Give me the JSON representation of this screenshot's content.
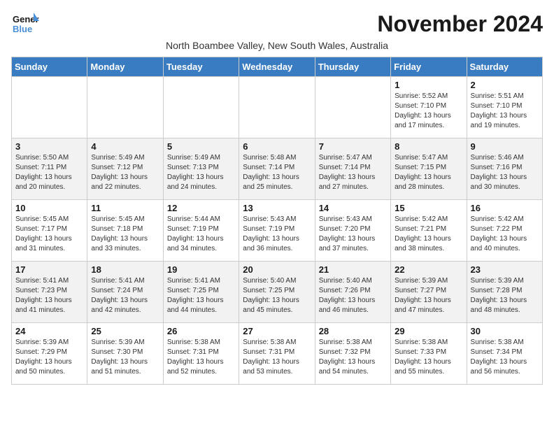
{
  "logo": {
    "line1": "General",
    "line2": "Blue"
  },
  "title": "November 2024",
  "subtitle": "North Boambee Valley, New South Wales, Australia",
  "days_of_week": [
    "Sunday",
    "Monday",
    "Tuesday",
    "Wednesday",
    "Thursday",
    "Friday",
    "Saturday"
  ],
  "weeks": [
    [
      {
        "day": "",
        "info": ""
      },
      {
        "day": "",
        "info": ""
      },
      {
        "day": "",
        "info": ""
      },
      {
        "day": "",
        "info": ""
      },
      {
        "day": "",
        "info": ""
      },
      {
        "day": "1",
        "info": "Sunrise: 5:52 AM\nSunset: 7:10 PM\nDaylight: 13 hours\nand 17 minutes."
      },
      {
        "day": "2",
        "info": "Sunrise: 5:51 AM\nSunset: 7:10 PM\nDaylight: 13 hours\nand 19 minutes."
      }
    ],
    [
      {
        "day": "3",
        "info": "Sunrise: 5:50 AM\nSunset: 7:11 PM\nDaylight: 13 hours\nand 20 minutes."
      },
      {
        "day": "4",
        "info": "Sunrise: 5:49 AM\nSunset: 7:12 PM\nDaylight: 13 hours\nand 22 minutes."
      },
      {
        "day": "5",
        "info": "Sunrise: 5:49 AM\nSunset: 7:13 PM\nDaylight: 13 hours\nand 24 minutes."
      },
      {
        "day": "6",
        "info": "Sunrise: 5:48 AM\nSunset: 7:14 PM\nDaylight: 13 hours\nand 25 minutes."
      },
      {
        "day": "7",
        "info": "Sunrise: 5:47 AM\nSunset: 7:14 PM\nDaylight: 13 hours\nand 27 minutes."
      },
      {
        "day": "8",
        "info": "Sunrise: 5:47 AM\nSunset: 7:15 PM\nDaylight: 13 hours\nand 28 minutes."
      },
      {
        "day": "9",
        "info": "Sunrise: 5:46 AM\nSunset: 7:16 PM\nDaylight: 13 hours\nand 30 minutes."
      }
    ],
    [
      {
        "day": "10",
        "info": "Sunrise: 5:45 AM\nSunset: 7:17 PM\nDaylight: 13 hours\nand 31 minutes."
      },
      {
        "day": "11",
        "info": "Sunrise: 5:45 AM\nSunset: 7:18 PM\nDaylight: 13 hours\nand 33 minutes."
      },
      {
        "day": "12",
        "info": "Sunrise: 5:44 AM\nSunset: 7:19 PM\nDaylight: 13 hours\nand 34 minutes."
      },
      {
        "day": "13",
        "info": "Sunrise: 5:43 AM\nSunset: 7:19 PM\nDaylight: 13 hours\nand 36 minutes."
      },
      {
        "day": "14",
        "info": "Sunrise: 5:43 AM\nSunset: 7:20 PM\nDaylight: 13 hours\nand 37 minutes."
      },
      {
        "day": "15",
        "info": "Sunrise: 5:42 AM\nSunset: 7:21 PM\nDaylight: 13 hours\nand 38 minutes."
      },
      {
        "day": "16",
        "info": "Sunrise: 5:42 AM\nSunset: 7:22 PM\nDaylight: 13 hours\nand 40 minutes."
      }
    ],
    [
      {
        "day": "17",
        "info": "Sunrise: 5:41 AM\nSunset: 7:23 PM\nDaylight: 13 hours\nand 41 minutes."
      },
      {
        "day": "18",
        "info": "Sunrise: 5:41 AM\nSunset: 7:24 PM\nDaylight: 13 hours\nand 42 minutes."
      },
      {
        "day": "19",
        "info": "Sunrise: 5:41 AM\nSunset: 7:25 PM\nDaylight: 13 hours\nand 44 minutes."
      },
      {
        "day": "20",
        "info": "Sunrise: 5:40 AM\nSunset: 7:25 PM\nDaylight: 13 hours\nand 45 minutes."
      },
      {
        "day": "21",
        "info": "Sunrise: 5:40 AM\nSunset: 7:26 PM\nDaylight: 13 hours\nand 46 minutes."
      },
      {
        "day": "22",
        "info": "Sunrise: 5:39 AM\nSunset: 7:27 PM\nDaylight: 13 hours\nand 47 minutes."
      },
      {
        "day": "23",
        "info": "Sunrise: 5:39 AM\nSunset: 7:28 PM\nDaylight: 13 hours\nand 48 minutes."
      }
    ],
    [
      {
        "day": "24",
        "info": "Sunrise: 5:39 AM\nSunset: 7:29 PM\nDaylight: 13 hours\nand 50 minutes."
      },
      {
        "day": "25",
        "info": "Sunrise: 5:39 AM\nSunset: 7:30 PM\nDaylight: 13 hours\nand 51 minutes."
      },
      {
        "day": "26",
        "info": "Sunrise: 5:38 AM\nSunset: 7:31 PM\nDaylight: 13 hours\nand 52 minutes."
      },
      {
        "day": "27",
        "info": "Sunrise: 5:38 AM\nSunset: 7:31 PM\nDaylight: 13 hours\nand 53 minutes."
      },
      {
        "day": "28",
        "info": "Sunrise: 5:38 AM\nSunset: 7:32 PM\nDaylight: 13 hours\nand 54 minutes."
      },
      {
        "day": "29",
        "info": "Sunrise: 5:38 AM\nSunset: 7:33 PM\nDaylight: 13 hours\nand 55 minutes."
      },
      {
        "day": "30",
        "info": "Sunrise: 5:38 AM\nSunset: 7:34 PM\nDaylight: 13 hours\nand 56 minutes."
      }
    ]
  ]
}
